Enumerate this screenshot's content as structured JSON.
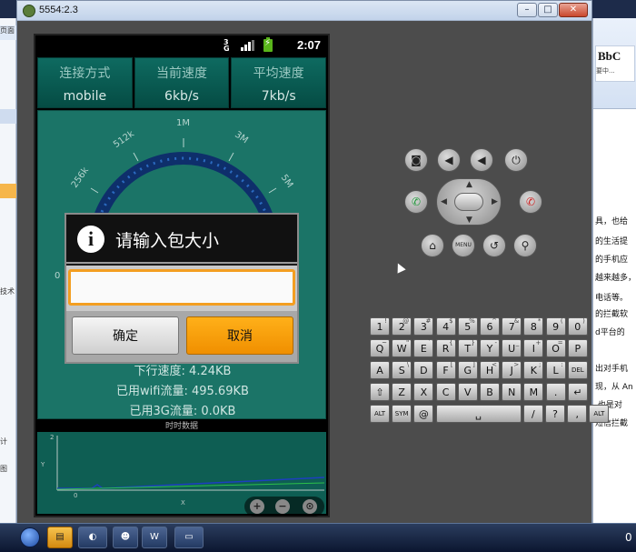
{
  "window": {
    "title": "5554:2.3",
    "buttons": {
      "minimize": "–",
      "maximize": "□",
      "close": "✕"
    }
  },
  "phone": {
    "status": {
      "time": "2:07",
      "network": "3G"
    },
    "header": [
      {
        "key": "连接方式",
        "value": "mobile"
      },
      {
        "key": "当前速度",
        "value": "6kb/s"
      },
      {
        "key": "平均速度",
        "value": "7kb/s"
      }
    ],
    "gauge": {
      "labels": [
        "0",
        "256k",
        "512k",
        "1M",
        "3M",
        "5M"
      ]
    },
    "stats": [
      "下行速度: 4.24KB",
      "已用wifi流量: 495.69KB",
      "已用3G流量: 0.0KB"
    ],
    "realtime_label": "时时数据",
    "chart_axis": {
      "y_tick": "2",
      "x_tick": "0",
      "x_label": "X",
      "y_label": "Y"
    },
    "dialog": {
      "title": "请输入包大小",
      "input_value": "",
      "ok_label": "确定",
      "cancel_label": "取消"
    }
  },
  "keyboard": {
    "row1": [
      "1",
      "2",
      "3",
      "4",
      "5",
      "6",
      "7",
      "8",
      "9",
      "0"
    ],
    "row1_sup": [
      "!",
      "@",
      "#",
      "$",
      "%",
      "^",
      "&",
      "*",
      "(",
      ")"
    ],
    "row2": [
      "Q",
      "W",
      "E",
      "R",
      "T",
      "Y",
      "U",
      "I",
      "O",
      "P"
    ],
    "row2_sup": [
      "~",
      "\"",
      "`",
      "{",
      "}",
      "-",
      "_",
      "+",
      "=",
      ""
    ],
    "row3": [
      "A",
      "S",
      "D",
      "F",
      "G",
      "H",
      "J",
      "K",
      "L",
      "DEL"
    ],
    "row3_sup": [
      "",
      "\\",
      "",
      "[",
      "]",
      "<",
      ">",
      ";",
      ":",
      ""
    ],
    "row4": [
      "⇧",
      "Z",
      "X",
      "C",
      "V",
      "B",
      "N",
      "M",
      ".",
      "↵"
    ],
    "row5": [
      "ALT",
      "SYM",
      "@",
      "␣",
      "/",
      "?",
      ",",
      "ALT"
    ]
  },
  "taskbar": {
    "tray": "0"
  },
  "background_right": {
    "style_title": "BbC",
    "style_sub": "要中...",
    "lines": [
      "具，也给",
      "的生活提",
      "的手机应",
      "越来越多，",
      "电话等。",
      "的拦截软",
      "d平台的",
      "出对手机",
      "现，从 An",
      ",也是对",
      "短信拦截"
    ]
  },
  "background_left": {
    "items": [
      "页面",
      "技术",
      "计",
      "图"
    ]
  }
}
